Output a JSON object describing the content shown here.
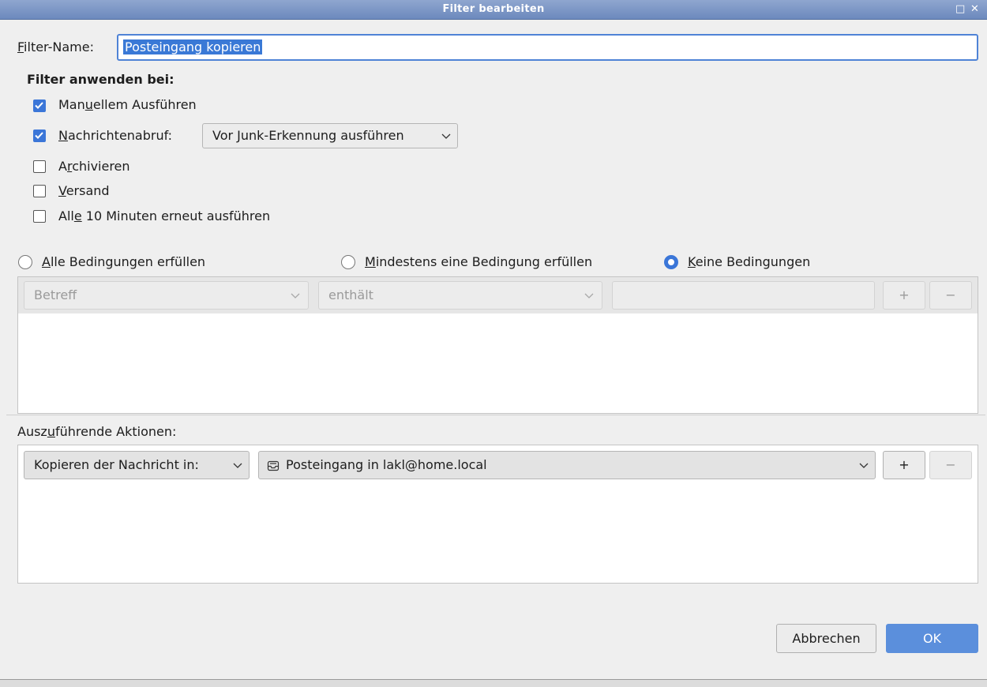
{
  "window": {
    "title": "Filter bearbeiten"
  },
  "filter_name": {
    "label": "Filter-Name:",
    "value": "Posteingang kopieren"
  },
  "apply_when": {
    "heading": "Filter anwenden bei:",
    "manual": {
      "label": "Manuellem Ausführen",
      "checked": true
    },
    "fetch": {
      "label": "Nachrichtenabruf:",
      "checked": true,
      "option": "Vor Junk-Erkennung ausführen"
    },
    "archive": {
      "label": "Archivieren",
      "checked": false
    },
    "send": {
      "label": "Versand",
      "checked": false
    },
    "periodic": {
      "label": "Alle 10 Minuten erneut ausführen",
      "checked": false
    }
  },
  "match": {
    "all": "Alle Bedingungen erfüllen",
    "any": "Mindestens eine Bedingung erfüllen",
    "none": "Keine Bedingungen",
    "selected": "none"
  },
  "condition": {
    "field": "Betreff",
    "operator": "enthält",
    "value": "",
    "add": "+",
    "remove": "−"
  },
  "actions": {
    "label": "Auszuführende Aktionen:",
    "action": "Kopieren der Nachricht in:",
    "target": "Posteingang in lakl@home.local",
    "add": "+",
    "remove": "−"
  },
  "buttons": {
    "cancel": "Abbrechen",
    "ok": "OK"
  },
  "colors": {
    "accent": "#3b76d8",
    "titlebar": "#7a94c6"
  }
}
